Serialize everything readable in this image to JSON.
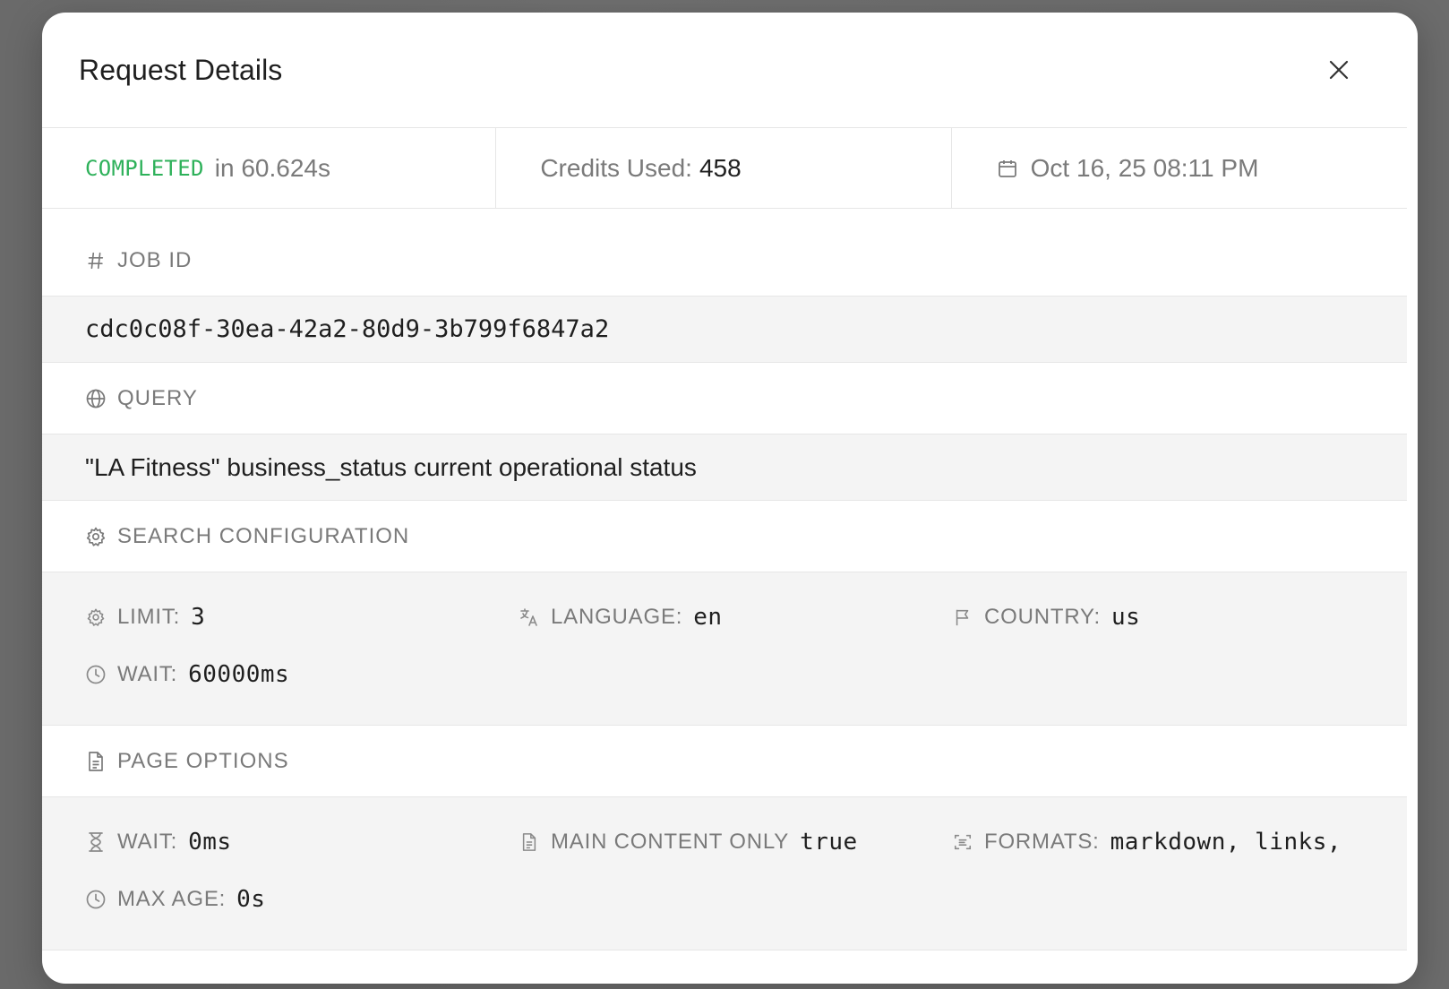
{
  "modal": {
    "title": "Request Details"
  },
  "stats": {
    "status": "COMPLETED",
    "duration": "in 60.624s",
    "credits_label": "Credits Used:",
    "credits_value": "458",
    "timestamp": "Oct 16, 25 08:11 PM"
  },
  "job": {
    "label": "JOB ID",
    "value": "cdc0c08f-30ea-42a2-80d9-3b799f6847a2"
  },
  "query": {
    "label": "QUERY",
    "value": "\"LA Fitness\" business_status current operational status"
  },
  "search_config": {
    "label": "SEARCH CONFIGURATION",
    "limit_label": "LIMIT:",
    "limit_value": "3",
    "language_label": "LANGUAGE:",
    "language_value": "en",
    "country_label": "COUNTRY:",
    "country_value": "us",
    "wait_label": "WAIT:",
    "wait_value": "60000ms"
  },
  "page_options": {
    "label": "PAGE OPTIONS",
    "wait_label": "WAIT:",
    "wait_value": "0ms",
    "main_content_label": "MAIN CONTENT ONLY",
    "main_content_value": "true",
    "formats_label": "FORMATS:",
    "formats_value": "markdown, links,",
    "max_age_label": "MAX AGE:",
    "max_age_value": "0s"
  },
  "colors": {
    "status_green": "#2eb15a",
    "muted_text": "#7a7a7a",
    "value_text": "#1f1f1f"
  }
}
